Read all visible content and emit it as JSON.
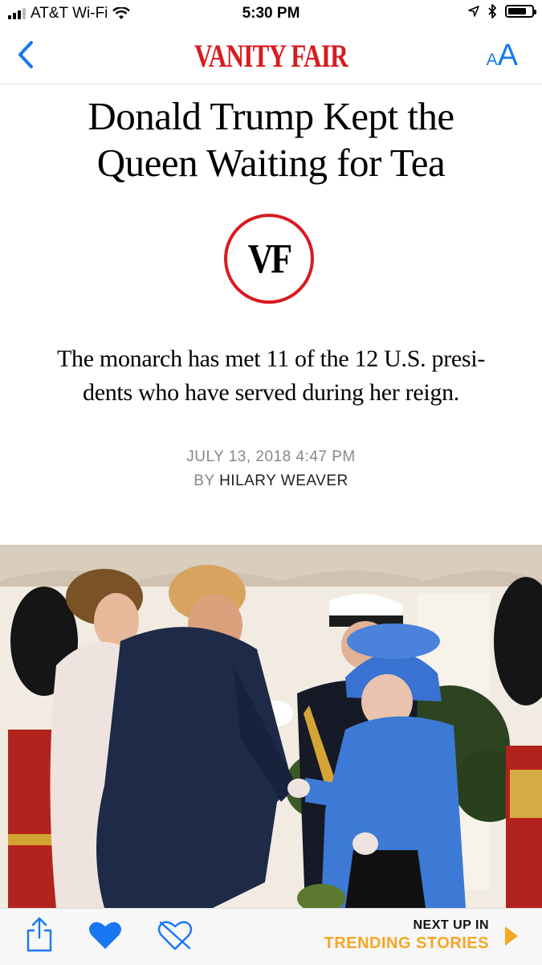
{
  "status_bar": {
    "carrier": "AT&T Wi-Fi",
    "time": "5:30 PM",
    "battery_level": 0.8
  },
  "nav": {
    "brand": "VANITY FAIR",
    "font_size_small": "A",
    "font_size_large": "A",
    "back_icon": "chevron-left-icon",
    "accent_color": "#1877f2",
    "brand_color": "#d81b21"
  },
  "article": {
    "headline_line1": "Donald Trump Kept the",
    "headline_line2": "Queen Waiting for Tea",
    "logo_text": "VF",
    "dek_line1": "The monarch has met 11 of the 12 U.S. presi-",
    "dek_line2": "dents who have served during her reign.",
    "date": "JULY 13, 2018 4:47 PM",
    "by": "BY",
    "author": "HILARY WEAVER"
  },
  "toolbar": {
    "share_icon": "share-icon",
    "like_icon": "heart-icon",
    "dislike_icon": "broken-heart-icon",
    "next_up_label": "NEXT UP IN",
    "next_up_section": "TRENDING STORIES",
    "next_icon": "play-icon",
    "next_color": "#f5a623"
  }
}
